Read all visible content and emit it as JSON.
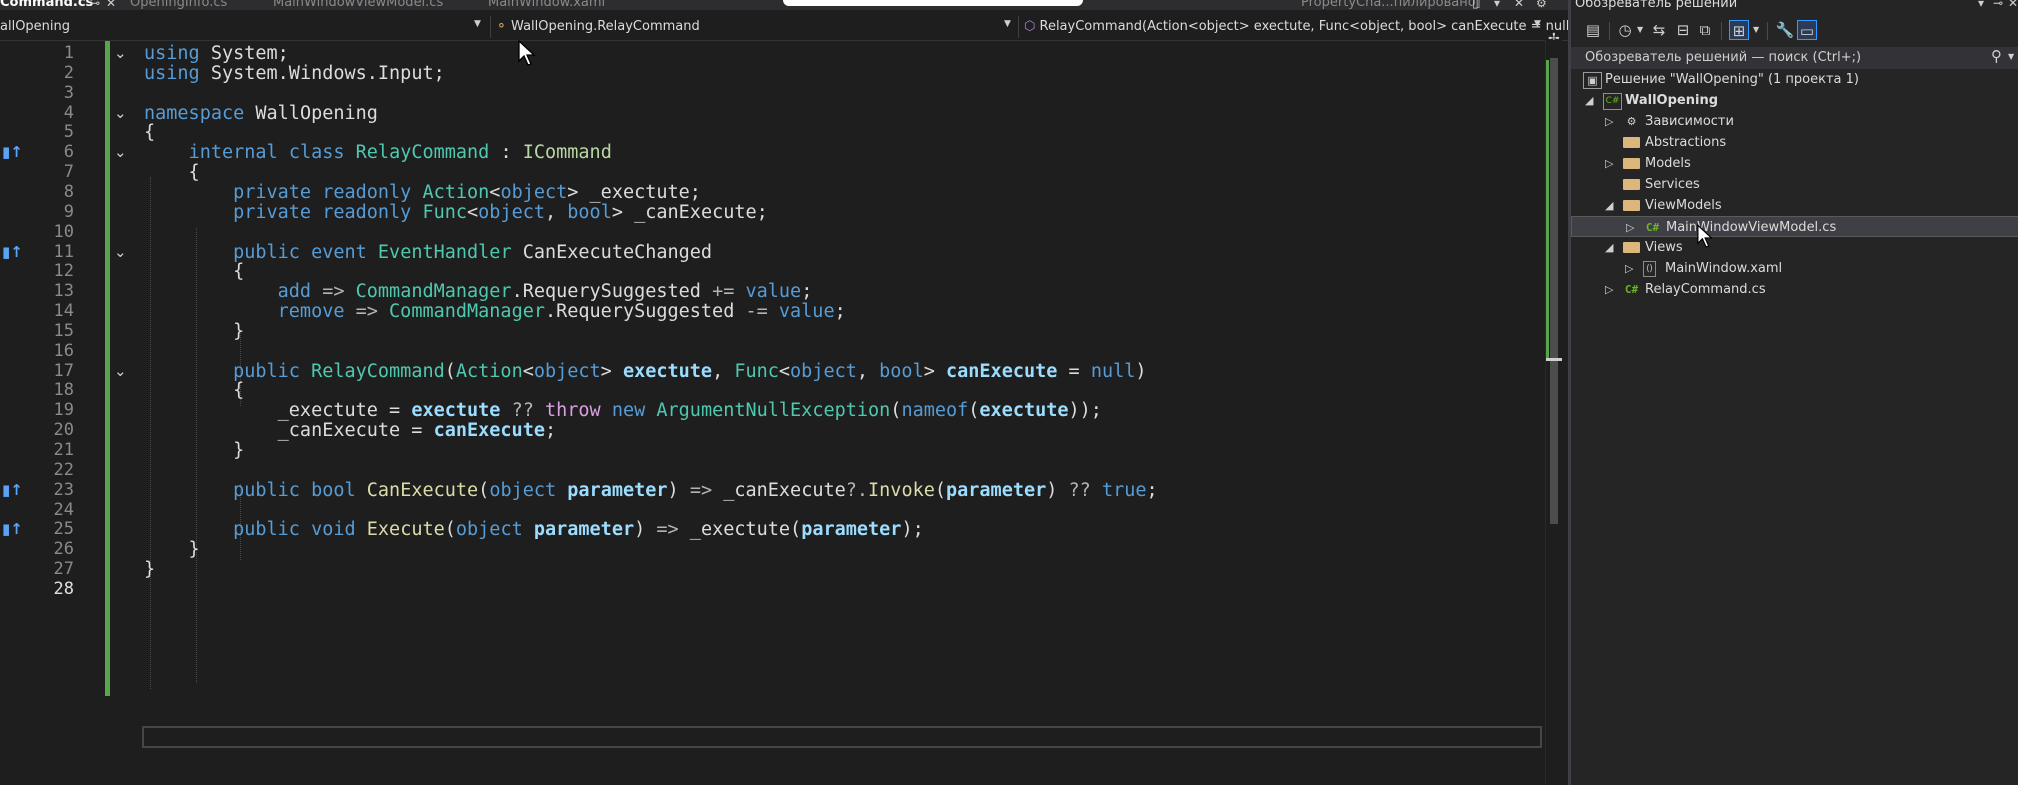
{
  "tabs": [
    {
      "label": "Command.cs",
      "active": true
    },
    {
      "label": "OpeningInfo.cs",
      "active": false
    },
    {
      "label": "MainWindowViewModel.cs",
      "active": false
    },
    {
      "label": "MainWindow.xaml",
      "active": false
    },
    {
      "label": "PropertyCha...пилировано]",
      "active": false
    }
  ],
  "navbar": {
    "project": "allOpening",
    "type": "WallOpening.RelayCommand",
    "member": "RelayCommand(Action<object> exectute, Func<object, bool> canExecute = null)"
  },
  "editor": {
    "current_line": 28,
    "line_numbers": [
      "1",
      "2",
      "3",
      "4",
      "5",
      "6",
      "7",
      "8",
      "9",
      "10",
      "11",
      "12",
      "13",
      "14",
      "15",
      "16",
      "17",
      "18",
      "19",
      "20",
      "21",
      "22",
      "23",
      "24",
      "25",
      "26",
      "27",
      "28"
    ],
    "code_lines": [
      "using System;",
      "using System.Windows.Input;",
      "",
      "namespace WallOpening",
      "{",
      "    internal class RelayCommand : ICommand",
      "    {",
      "        private readonly Action<object> _exectute;",
      "        private readonly Func<object, bool> _canExecute;",
      "",
      "        public event EventHandler CanExecuteChanged",
      "        {",
      "            add => CommandManager.RequerySuggested += value;",
      "            remove => CommandManager.RequerySuggested -= value;",
      "        }",
      "",
      "        public RelayCommand(Action<object> exectute, Func<object, bool> canExecute = null)",
      "        {",
      "            _exectute = exectute ?? throw new ArgumentNullException(nameof(exectute));",
      "            _canExecute = canExecute;",
      "        }",
      "",
      "        public bool CanExecute(object parameter) => _canExecute?.Invoke(parameter) ?? true;",
      "",
      "        public void Execute(object parameter) => _exectute(parameter);",
      "    }",
      "}",
      ""
    ],
    "fold_lines": [
      1,
      4,
      6,
      11,
      17
    ],
    "implements_markers": [
      6,
      11,
      23,
      25
    ]
  },
  "solution_explorer": {
    "title": "Обозреватель решений",
    "search_placeholder": "Обозреватель решений — поиск (Ctrl+;)",
    "items": [
      {
        "label": "Решение \"WallOpening\"  (1 проекта 1)",
        "icon": "solution-icon",
        "expander": "",
        "bold": false
      },
      {
        "label": "WallOpening",
        "icon": "csharp-project-icon",
        "expander": "◢",
        "bold": true
      },
      {
        "label": "Зависимости",
        "icon": "dependencies-icon",
        "expander": "▷",
        "bold": false
      },
      {
        "label": "Abstractions",
        "icon": "folder-icon",
        "expander": "",
        "bold": false
      },
      {
        "label": "Models",
        "icon": "folder-icon",
        "expander": "▷",
        "bold": false
      },
      {
        "label": "Services",
        "icon": "folder-icon",
        "expander": "",
        "bold": false
      },
      {
        "label": "ViewModels",
        "icon": "folder-icon",
        "expander": "◢",
        "bold": false
      },
      {
        "label": "MainWindowViewModel.cs",
        "icon": "csharp-file-icon",
        "expander": "▷",
        "bold": false
      },
      {
        "label": "Views",
        "icon": "folder-icon",
        "expander": "◢",
        "bold": false
      },
      {
        "label": "MainWindow.xaml",
        "icon": "xaml-file-icon",
        "expander": "▷",
        "bold": false
      },
      {
        "label": "RelayCommand.cs",
        "icon": "csharp-file-icon",
        "expander": "▷",
        "bold": false
      }
    ],
    "selected_item": "MainWindowViewModel.cs"
  },
  "colors": {
    "editor_bg": "#1e1e1e",
    "keyword": "#569cd6",
    "type": "#4ec9b0",
    "interface": "#b8d7a3",
    "control_keyword": "#d8a0df",
    "parameter": "#9cdcfe",
    "method": "#dcdcaa",
    "change_bar": "#57a64a",
    "panel_bg": "#252526",
    "folder": "#dcb67a"
  }
}
